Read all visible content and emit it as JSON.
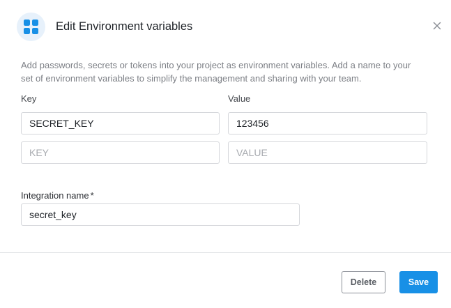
{
  "dialog": {
    "title": "Edit Environment variables",
    "description": "Add passwords, secrets or tokens into your project as environment variables. Add a name to your set of environment variables to simplify the management and sharing with your team."
  },
  "form": {
    "key_label": "Key",
    "value_label": "Value",
    "rows": [
      {
        "key": "SECRET_KEY",
        "value": "123456",
        "key_placeholder": "",
        "value_placeholder": ""
      },
      {
        "key": "",
        "value": "",
        "key_placeholder": "KEY",
        "value_placeholder": "VALUE"
      }
    ],
    "integration_name_label": "Integration name",
    "required_marker": "*",
    "integration_name_value": "secret_key"
  },
  "footer": {
    "delete_label": "Delete",
    "save_label": "Save"
  },
  "icons": {
    "header": "grid-apps-icon",
    "close": "close-icon"
  },
  "colors": {
    "accent": "#1890e6",
    "icon_bg": "#e7f1fb"
  }
}
